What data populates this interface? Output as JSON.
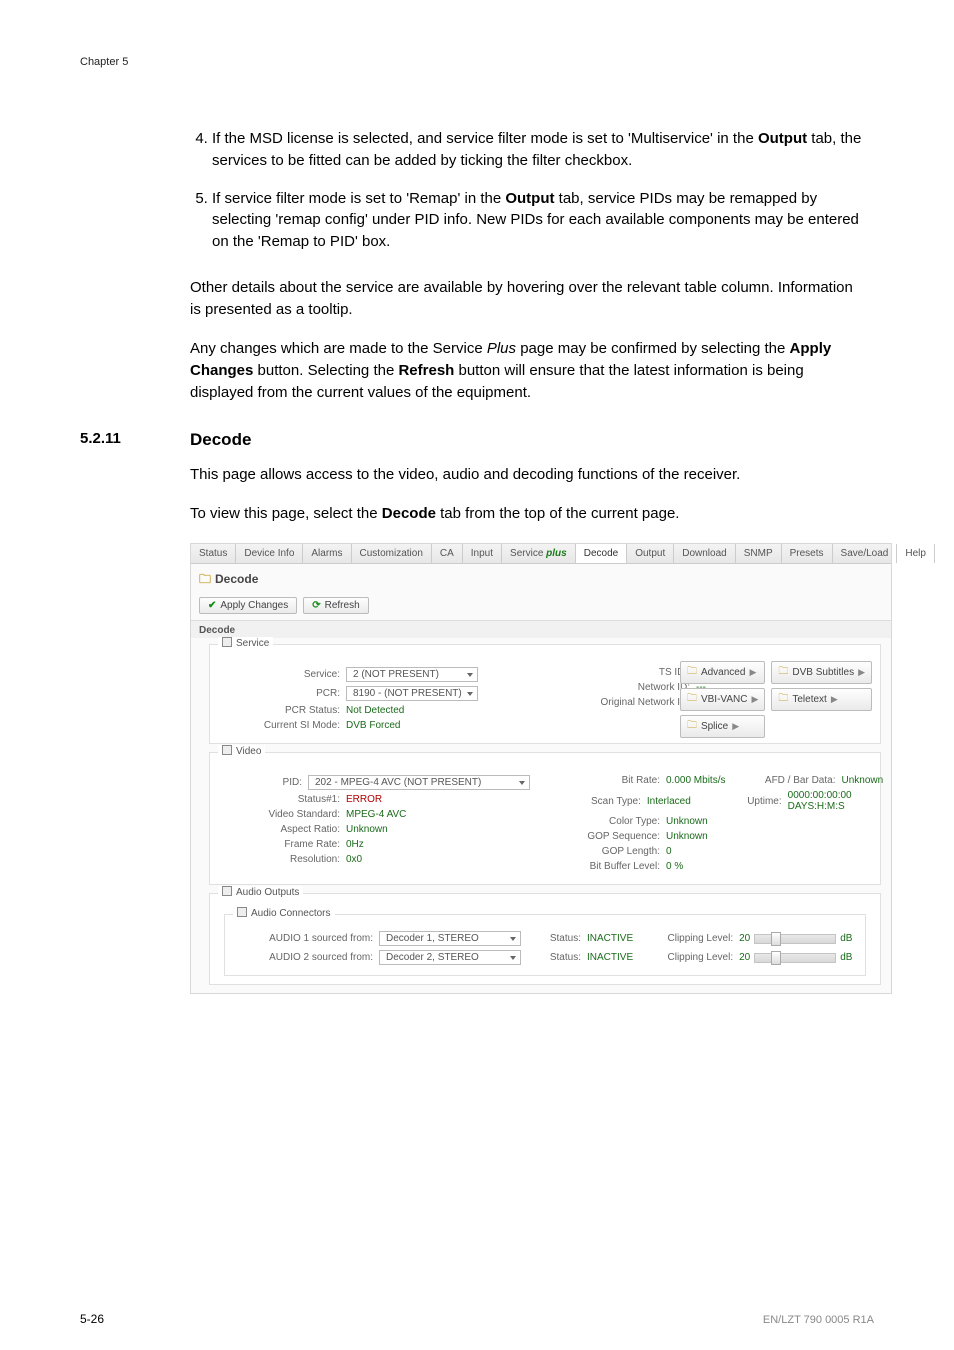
{
  "header": {
    "chapter": "Chapter 5"
  },
  "list_items": {
    "four": "If the MSD license is selected, and service filter mode is set to 'Multiservice' in the Output tab, the services to be fitted can be added by ticking the filter checkbox.",
    "five": "If service filter mode is set to 'Remap' in the Output tab, service PIDs may be remapped by selecting 'remap config' under PID info. New PIDs for each available components may be entered on the 'Remap to PID' box."
  },
  "list_bold": {
    "output": "Output"
  },
  "paras": {
    "p1": "Other details about the service are available by hovering over the relevant table column. Information is presented as a tooltip.",
    "p2a": "Any changes which are made to the Service ",
    "p2_plus": "Plus",
    "p2b": " page may be confirmed by selecting the ",
    "p2_apply": "Apply Changes",
    "p2c": " button. Selecting the ",
    "p2_refresh": "Refresh",
    "p2d": " button will ensure that the latest information is being displayed from the current values of the equipment."
  },
  "section": {
    "num": "5.2.11",
    "title": "Decode"
  },
  "section_paras": {
    "intro": "This page allows access to the video, audio and decoding functions of the receiver.",
    "view_a": "To view this page, select the ",
    "view_b": "Decode",
    "view_c": " tab from the top of the current page."
  },
  "shot": {
    "tabs": [
      "Status",
      "Device Info",
      "Alarms",
      "Customization",
      "CA",
      "Input",
      "Service",
      "plus",
      "Decode",
      "Output",
      "Download",
      "SNMP",
      "Presets",
      "Save/Load",
      "Help"
    ],
    "panel_title": "Decode",
    "apply": "Apply Changes",
    "refresh": "Refresh",
    "section_decode": "Decode",
    "service": {
      "legend": "Service",
      "rows": {
        "service_label": "Service:",
        "service_value": "2 (NOT PRESENT)",
        "pcr_label": "PCR:",
        "pcr_value": "8190 - (NOT PRESENT)",
        "pcr_status_label": "PCR Status:",
        "pcr_status_value": "Not Detected",
        "si_label": "Current SI Mode:",
        "si_value": "DVB Forced"
      },
      "right": {
        "tsid_label": "TS ID :",
        "tsid_value": "---",
        "nid_label": "Network ID:",
        "nid_value": "---",
        "onid_label": "Original Network ID:",
        "onid_value": "---"
      },
      "btns": {
        "advanced": "Advanced",
        "dvbsub": "DVB Subtitles",
        "vbivanc": "VBI-VANC",
        "teletext": "Teletext",
        "splice": "Splice"
      }
    },
    "video": {
      "legend": "Video",
      "left": {
        "pid_label": "PID:",
        "pid_value": "202 - MPEG-4 AVC (NOT PRESENT)",
        "status1_label": "Status#1:",
        "status1_value": "ERROR",
        "std_label": "Video Standard:",
        "std_value": "MPEG-4 AVC",
        "aspect_label": "Aspect Ratio:",
        "aspect_value": "Unknown",
        "fr_label": "Frame Rate:",
        "fr_value": "0Hz",
        "res_label": "Resolution:",
        "res_value": "0x0"
      },
      "right": {
        "bitrate_label": "Bit Rate:",
        "bitrate_value": "0.000 Mbits/s",
        "afd_label": "AFD / Bar Data:",
        "afd_value": "Unknown",
        "scan_label": "Scan Type:",
        "scan_value": "Interlaced",
        "uptime_label": "Uptime:",
        "uptime_value": "0000:00:00:00 DAYS:H:M:S",
        "color_label": "Color Type:",
        "color_value": "Unknown",
        "gopseq_label": "GOP Sequence:",
        "gopseq_value": "Unknown",
        "goplen_label": "GOP Length:",
        "goplen_value": "0",
        "bbl_label": "Bit Buffer Level:",
        "bbl_value": "0 %"
      }
    },
    "audio_out": {
      "legend": "Audio Outputs"
    },
    "audio_con": {
      "legend": "Audio Connectors",
      "rows": [
        {
          "src_label": "AUDIO 1 sourced from:",
          "src_value": "Decoder 1, STEREO",
          "status_label": "Status:",
          "status_value": "INACTIVE",
          "clip_label": "Clipping Level:",
          "clip_value": "20",
          "db": "dB"
        },
        {
          "src_label": "AUDIO 2 sourced from:",
          "src_value": "Decoder 2, STEREO",
          "status_label": "Status:",
          "status_value": "INACTIVE",
          "clip_label": "Clipping Level:",
          "clip_value": "20",
          "db": "dB"
        }
      ]
    }
  },
  "footer": {
    "page": "5-26",
    "docid": "EN/LZT 790 0005 R1A"
  }
}
